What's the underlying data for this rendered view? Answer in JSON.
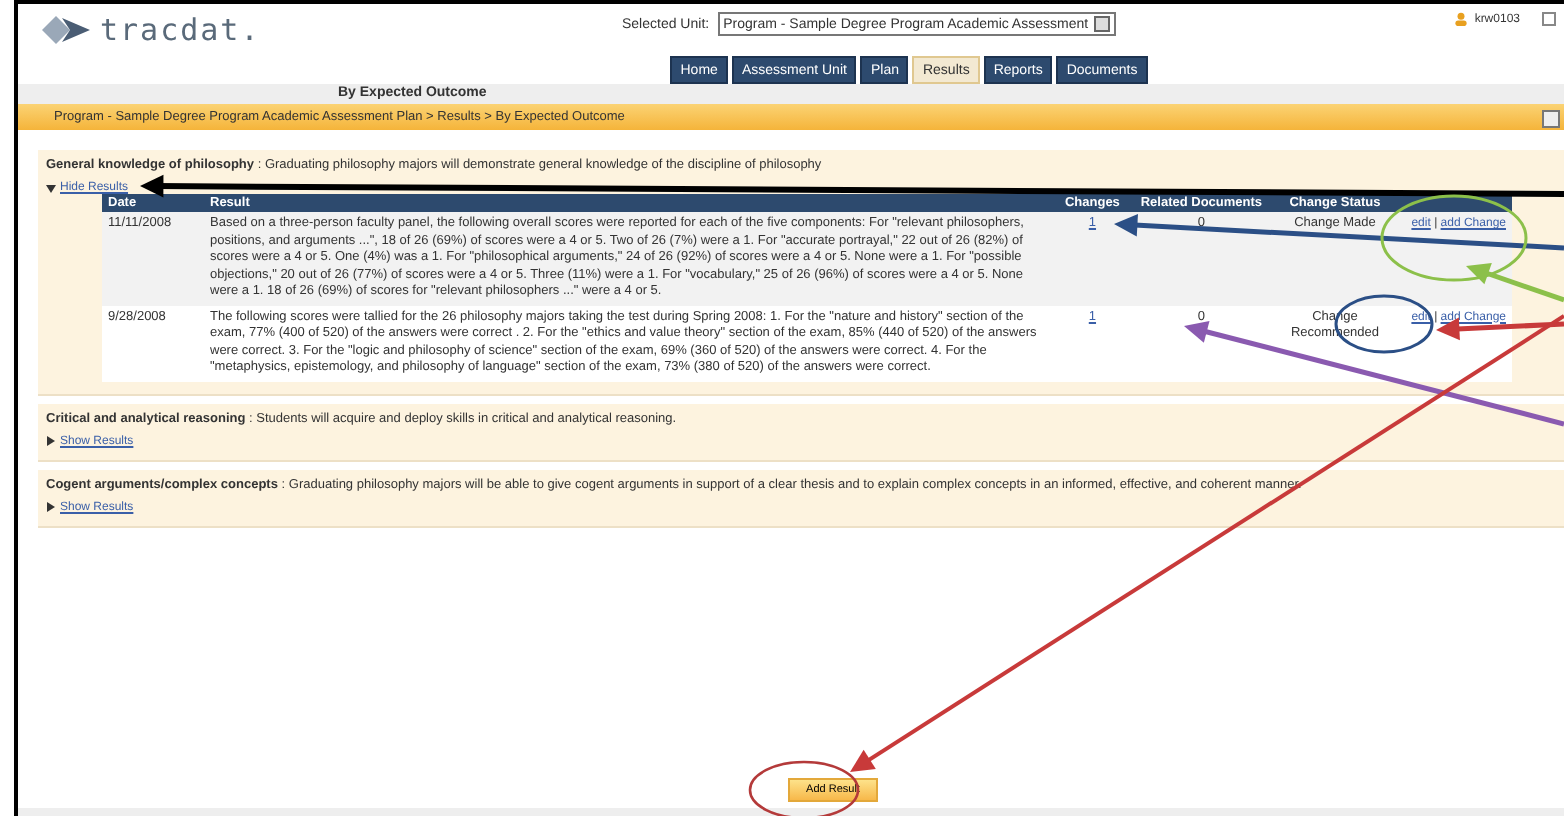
{
  "header": {
    "logo": "tracdat.",
    "unit_label": "Selected Unit:",
    "unit_value": "Program - Sample Degree Program Academic Assessment",
    "user": "krw0103"
  },
  "tabs": [
    {
      "label": "Home",
      "selected": false
    },
    {
      "label": "Assessment Unit",
      "selected": false
    },
    {
      "label": "Plan",
      "selected": false
    },
    {
      "label": "Results",
      "selected": true
    },
    {
      "label": "Reports",
      "selected": false
    },
    {
      "label": "Documents",
      "selected": false
    }
  ],
  "page_title": "By Expected Outcome",
  "breadcrumb": "Program - Sample Degree Program Academic Assessment Plan > Results > By Expected Outcome",
  "outcomes": [
    {
      "title": "General knowledge of philosophy",
      "separator": ":",
      "description": "Graduating philosophy majors will demonstrate general knowledge of the discipline of philosophy",
      "toggle": "Hide Results",
      "expanded": true,
      "table": {
        "columns": [
          "Date",
          "Result",
          "Changes",
          "Related Documents",
          "Change Status"
        ],
        "rows": [
          {
            "date": "11/11/2008",
            "result": "Based on a three-person faculty panel, the following overall scores were reported for each of the five components: For \"relevant philosophers, positions, and arguments ...\", 18 of 26 (69%) of scores were a 4 or 5. Two of 26 (7%) were a 1. For \"accurate portrayal,\" 22 out of 26 (82%) of scores were a 4 or 5. One (4%) was a 1. For \"philosophical arguments,\" 24 of 26 (92%) of scores were a 4 or 5. None were a 1. For \"possible objections,\" 20 out of 26 (77%) of scores were a 4 or 5. Three (11%) were a 1. For \"vocabulary,\" 25 of 26 (96%) of scores were a 4 or 5. None were a 1. 18 of 26 (69%) of scores for \"relevant philosophers ...\" were a 4 or 5.",
            "changes": "1",
            "related_documents": "0",
            "change_status": "Change Made",
            "actions": [
              "edit",
              "add Change"
            ],
            "action_separator": "|"
          },
          {
            "date": "9/28/2008",
            "result": "The following scores were tallied for the 26 philosophy majors taking the test during Spring 2008: 1. For the \"nature and history\" section of the exam, 77% (400 of 520) of the answers were correct . 2. For the \"ethics and value theory\" section of the exam, 85% (440 of 520) of the answers were correct. 3. For the \"logic and philosophy of science\" section of the exam, 69% (360 of 520) of the answers were correct. 4. For the \"metaphysics, epistemology, and philosophy of language\" section of the exam, 73% (380 of 520) of the answers were correct.",
            "changes": "1",
            "related_documents": "0",
            "change_status": "Change Recommended",
            "actions": [
              "edit",
              "add Change"
            ],
            "action_separator": "|"
          }
        ]
      }
    },
    {
      "title": "Critical and analytical reasoning",
      "separator": ":",
      "description": "Students will acquire and deploy skills in critical and analytical reasoning.",
      "toggle": "Show Results",
      "expanded": false
    },
    {
      "title": "Cogent arguments/complex concepts",
      "separator": ":",
      "description": "Graduating philosophy majors will be able to give cogent arguments in support of a clear thesis and to explain complex concepts in an informed, effective, and coherent manner.",
      "toggle": "Show Results",
      "expanded": false
    }
  ],
  "add_result": "Add Result"
}
